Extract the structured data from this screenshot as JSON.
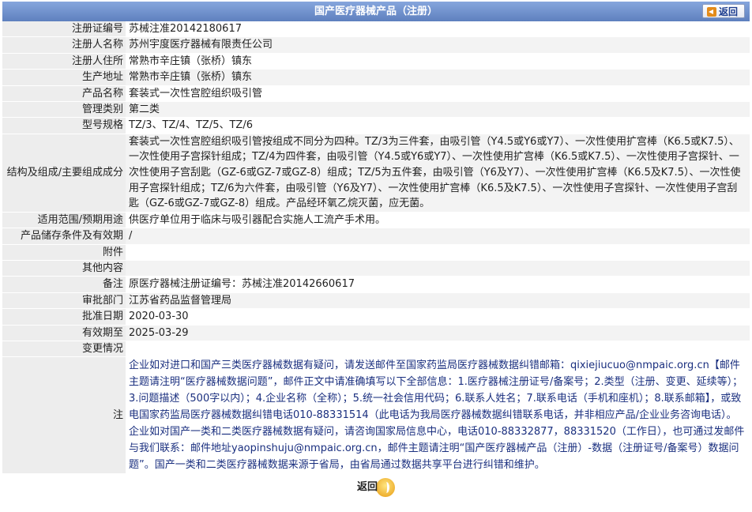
{
  "header": {
    "title": "国产医疗器械产品（注册）",
    "back_label": "返回"
  },
  "rows": [
    {
      "label": "注册证编号",
      "value": "苏械注准20142180617"
    },
    {
      "label": "注册人名称",
      "value": "苏州宇度医疗器械有限责任公司"
    },
    {
      "label": "注册人住所",
      "value": "常熟市辛庄镇（张桥）镇东"
    },
    {
      "label": "生产地址",
      "value": "常熟市辛庄镇（张桥）镇东"
    },
    {
      "label": "产品名称",
      "value": "套装式一次性宫腔组织吸引管"
    },
    {
      "label": "管理类别",
      "value": "第二类"
    },
    {
      "label": "型号规格",
      "value": "TZ/3、TZ/4、TZ/5、TZ/6"
    },
    {
      "label": "结构及组成/主要组成成分",
      "value": "套装式一次性宫腔组织吸引管按组成不同分为四种。TZ/3为三件套，由吸引管（Y4.5或Y6或Y7）、一次性使用扩宫棒（K6.5或K7.5）、一次性使用子宫探针组成；TZ/4为四件套，由吸引管（Y4.5或Y6或Y7）、一次性使用扩宫棒（K6.5或K7.5）、一次性使用子宫探针、一次性使用子宫刮匙（GZ-6或GZ-7或GZ-8）组成；TZ/5为五件套，由吸引管（Y6及Y7）、一次性使用扩宫棒（K6.5及K7.5）、一次性使用子宫探针组成；TZ/6为六件套，由吸引管（Y6及Y7）、一次性使用扩宫棒（K6.5及K7.5）、一次性使用子宫探针、一次性使用子宫刮匙（GZ-6或GZ-7或GZ-8）组成。产品经环氧乙烷灭菌，应无菌。"
    },
    {
      "label": "适用范围/预期用途",
      "value": "供医疗单位用于临床与吸引器配合实施人工流产手术用。"
    },
    {
      "label": "产品储存条件及有效期",
      "value": "/"
    },
    {
      "label": "附件",
      "value": ""
    },
    {
      "label": "其他内容",
      "value": ""
    },
    {
      "label": "备注",
      "value": "原医疗器械注册证编号：苏械注准20142660617"
    },
    {
      "label": "审批部门",
      "value": "江苏省药品监督管理局"
    },
    {
      "label": "批准日期",
      "value": "2020-03-30"
    },
    {
      "label": "有效期至",
      "value": "2025-03-29"
    },
    {
      "label": "变更情况",
      "value": ""
    }
  ],
  "note": {
    "label": "注",
    "value": "企业如对进口和国产三类医疗器械数据有疑问，请发送邮件至国家药监局医疗器械数据纠错邮箱：qixiejiucuo@nmpaic.org.cn【邮件主题请注明“医疗器械数据问题”，邮件正文中请准确填写以下全部信息：1.医疗器械注册证号/备案号；2.类型（注册、变更、延续等）；3.问题描述（500字以内）；4.企业名称（全称）；5.统一社会信用代码；6.联系人姓名；7.联系电话（手机和座机）；8.联系邮箱】，或致电国家药监局医疗器械数据纠错电话010-88331514（此电话为我局医疗器械数据纠错联系电话，并非相应产品/企业业务咨询电话）。企业如对国产一类和二类医疗器械数据有疑问，请咨询国家局信息中心，电话010-88332877，88331520（工作日），也可通过发邮件与我们联系：邮件地址yaopinshuju@nmpaic.org.cn，邮件主题请注明“国产医疗器械产品（注册）-数据（注册证号/备案号）数据问题”。国产一类和二类医疗器械数据来源于省局，由省局通过数据共享平台进行纠错和维护。"
  },
  "footer": {
    "back_label": "返回"
  }
}
